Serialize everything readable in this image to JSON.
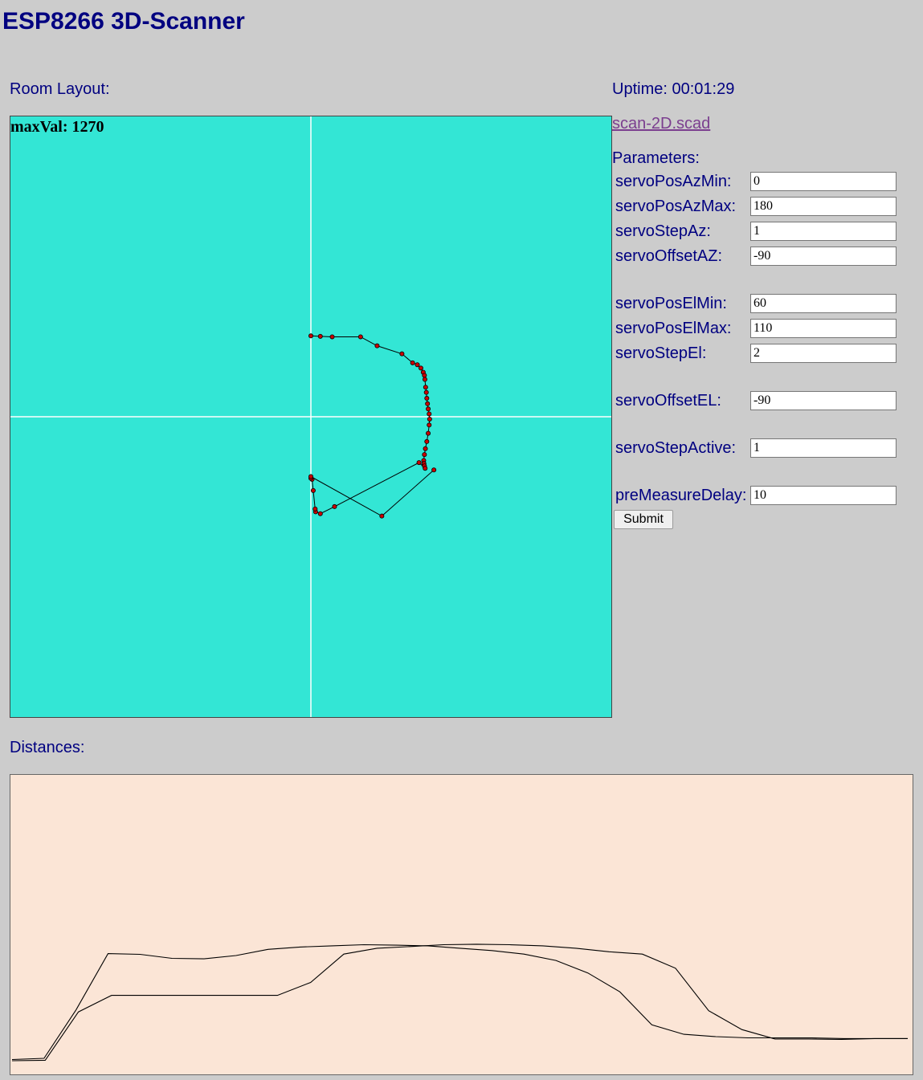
{
  "title": "ESP8266 3D-Scanner",
  "room_layout_label": "Room Layout:",
  "max_val": "maxVal: 1270",
  "uptime": "Uptime: 00:01:29",
  "scad_link": "scan-2D.scad",
  "parameters_label": "Parameters:",
  "params": {
    "servoPosAzMin": {
      "label": "servoPosAzMin:",
      "value": "0"
    },
    "servoPosAzMax": {
      "label": "servoPosAzMax:",
      "value": "180"
    },
    "servoStepAz": {
      "label": "servoStepAz:",
      "value": "1"
    },
    "servoOffsetAZ": {
      "label": "servoOffsetAZ:",
      "value": "-90"
    },
    "servoPosElMin": {
      "label": "servoPosElMin:",
      "value": "60"
    },
    "servoPosElMax": {
      "label": "servoPosElMax:",
      "value": "110"
    },
    "servoStepEl": {
      "label": "servoStepEl:",
      "value": "2"
    },
    "servoOffsetEL": {
      "label": "servoOffsetEL:",
      "value": "-90"
    },
    "servoStepActive": {
      "label": "servoStepActive:",
      "value": "1"
    },
    "preMeasureDelay": {
      "label": "preMeasureDelay:",
      "value": "10"
    }
  },
  "submit_label": "Submit",
  "distances_label": "Distances:",
  "colors": {
    "background": "#cccccc",
    "text": "#000080",
    "room_bg": "#33e6d5",
    "distances_bg": "#fbe5d6",
    "point_fill": "#cc0000",
    "link": "#7b3e8f"
  },
  "chart_data": [
    {
      "type": "scatter",
      "max_value": 1270,
      "grid": "crosshair at origin",
      "points": [
        [
          0,
          342
        ],
        [
          40,
          340
        ],
        [
          90,
          338
        ],
        [
          210,
          338
        ],
        [
          280,
          300
        ],
        [
          385,
          266
        ],
        [
          430,
          228
        ],
        [
          450,
          220
        ],
        [
          465,
          206
        ],
        [
          475,
          188
        ],
        [
          480,
          175
        ],
        [
          482,
          158
        ],
        [
          485,
          125
        ],
        [
          488,
          103
        ],
        [
          490,
          78
        ],
        [
          493,
          55
        ],
        [
          496,
          33
        ],
        [
          500,
          12
        ],
        [
          502,
          -10
        ],
        [
          500,
          -35
        ],
        [
          496,
          -70
        ],
        [
          490,
          -105
        ],
        [
          484,
          -135
        ],
        [
          480,
          -160
        ],
        [
          477,
          -185
        ],
        [
          478,
          -198
        ],
        [
          480,
          -208
        ],
        [
          483,
          -218
        ],
        [
          457,
          -194
        ],
        [
          100,
          -380
        ],
        [
          40,
          -410
        ],
        [
          20,
          -402
        ],
        [
          18,
          -390
        ],
        [
          10,
          -312
        ],
        [
          5,
          -265
        ],
        [
          0,
          -260
        ],
        [
          0,
          -253
        ],
        [
          300,
          -420
        ],
        [
          520,
          -225
        ]
      ]
    },
    {
      "type": "line",
      "series": [
        {
          "values": [
            1207,
            1202,
            997,
            758,
            761,
            778,
            780,
            766,
            740,
            730,
            725,
            720,
            722,
            725,
            735,
            745,
            760,
            787,
            840,
            920,
            1060,
            1100,
            1110,
            1115,
            1115,
            1115,
            1118,
            1118,
            1118
          ]
        },
        {
          "values": [
            1212,
            1210,
            1005,
            935,
            935,
            935,
            935,
            935,
            935,
            880,
            760,
            735,
            728,
            720,
            718,
            720,
            725,
            735,
            750,
            760,
            820,
            1000,
            1080,
            1120,
            1120,
            1122,
            1118,
            1118
          ]
        }
      ]
    }
  ]
}
